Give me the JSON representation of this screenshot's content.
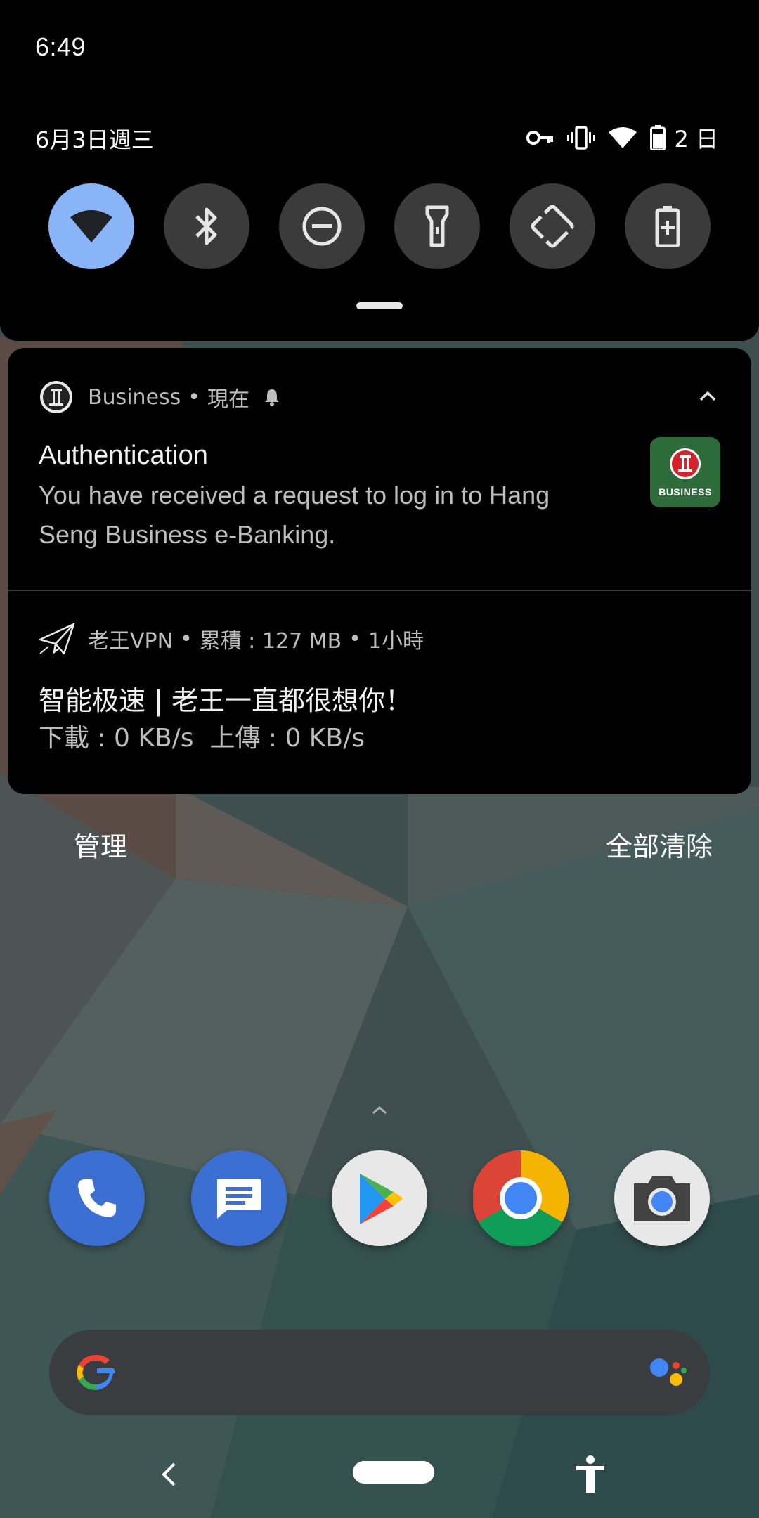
{
  "status_bar": {
    "time": "6:49",
    "date": "6月3日週三",
    "battery_text": "2 日",
    "icons": [
      "vpn-key-icon",
      "vibrate-icon",
      "wifi-icon",
      "battery-icon"
    ]
  },
  "quick_settings": {
    "tiles": [
      {
        "name": "wifi",
        "icon": "wifi-icon",
        "active": true
      },
      {
        "name": "bluetooth",
        "icon": "bluetooth-icon",
        "active": false
      },
      {
        "name": "do-not-disturb",
        "icon": "dnd-icon",
        "active": false
      },
      {
        "name": "flashlight",
        "icon": "flashlight-icon",
        "active": false
      },
      {
        "name": "auto-rotate",
        "icon": "rotate-icon",
        "active": false
      },
      {
        "name": "battery-saver",
        "icon": "battery-saver-icon",
        "active": false
      }
    ],
    "active_color": "#8ab4f8"
  },
  "notifications": [
    {
      "app": "Business",
      "time": "現在",
      "title": "Authentication",
      "body_line1": "You have received a request to log in to Hang",
      "body_line2": "Seng Business e-Banking.",
      "large_icon_label": "BUSINESS",
      "large_icon_color": "#2e6b3a"
    },
    {
      "app": "老王VPN",
      "extra": "累積 : 127 MB",
      "time": "1小時",
      "title": "智能极速 | 老王一直都很想你！",
      "body": "下載 : 0 KB/s  上傳 : 0 KB/s"
    }
  ],
  "footer": {
    "manage": "管理",
    "clear_all": "全部清除"
  },
  "dock": {
    "apps": [
      "phone-icon",
      "messages-icon",
      "play-store-icon",
      "chrome-icon",
      "camera-icon"
    ]
  },
  "nav": [
    "back-icon",
    "home-pill",
    "accessibility-icon"
  ]
}
